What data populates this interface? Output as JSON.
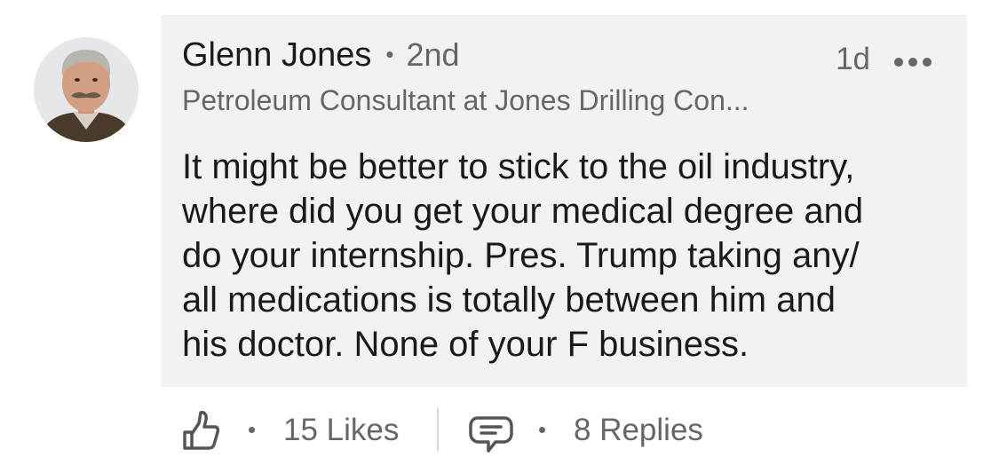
{
  "author": {
    "name": "Glenn Jones",
    "separator": "•",
    "degree": "2nd",
    "headline": "Petroleum Consultant at Jones Drilling Con...",
    "avatar_icon": "profile-photo"
  },
  "comment": {
    "timestamp": "1d",
    "more_icon": "ellipsis-horizontal-icon",
    "lines": [
      "It might be better to stick to the oil industry,",
      "where did you get your medical degree and",
      "do your internship. Pres. Trump taking any/",
      "all medications is totally between him and",
      "his doctor. None of your F business."
    ]
  },
  "actions": {
    "like_icon": "thumbs-up-icon",
    "separator": "•",
    "likes_label": "15 Likes",
    "reply_icon": "comment-bubble-icon",
    "replies_label": "8 Replies"
  },
  "colors": {
    "bubble_background": "#f2f2f2",
    "primary_text": "#1a1a1a",
    "secondary_text": "#666666"
  }
}
